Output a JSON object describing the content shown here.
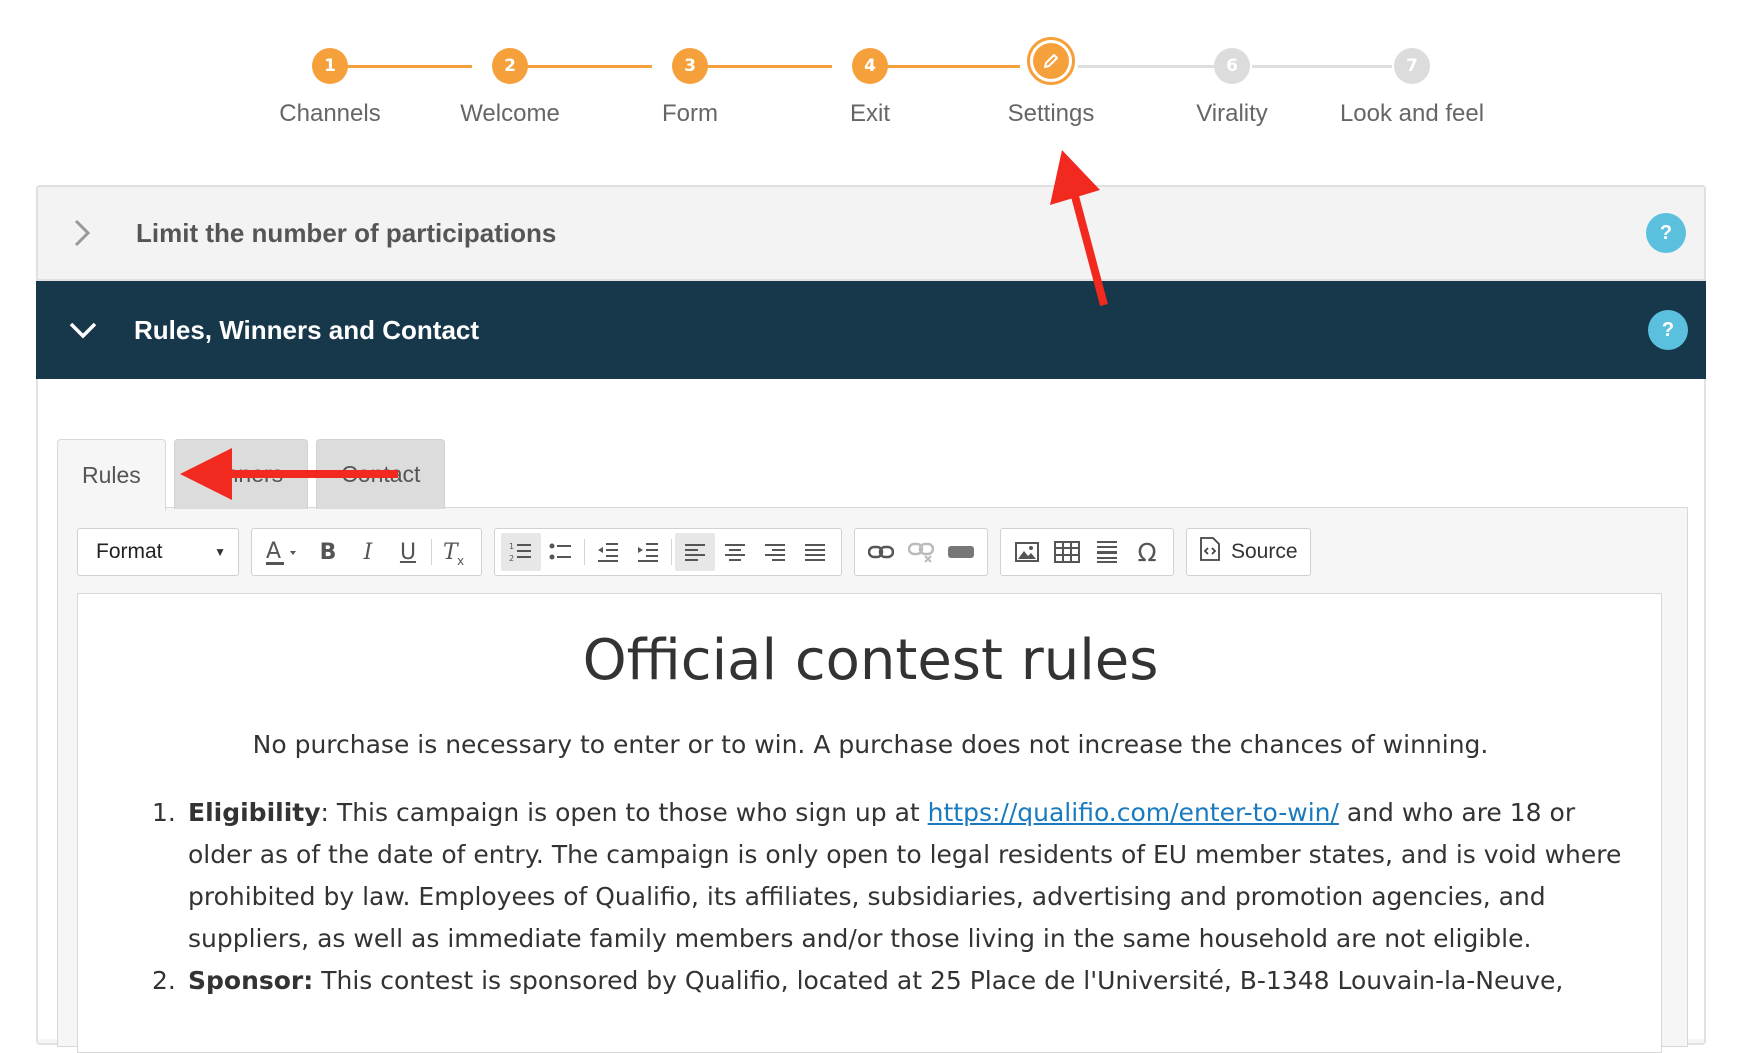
{
  "stepper": {
    "steps": [
      {
        "number": "1",
        "label": "Channels"
      },
      {
        "number": "2",
        "label": "Welcome"
      },
      {
        "number": "3",
        "label": "Form"
      },
      {
        "number": "4",
        "label": "Exit"
      },
      {
        "number": "",
        "label": "Settings"
      },
      {
        "number": "6",
        "label": "Virality"
      },
      {
        "number": "7",
        "label": "Look and feel"
      }
    ],
    "current_step": "Settings",
    "colors": {
      "done": "#f5a03a",
      "inactive": "#dcdcdc"
    }
  },
  "accordion": {
    "limit_title": "Limit the number of participations",
    "rules_title": "Rules, Winners and Contact",
    "help_label": "?"
  },
  "tabs": [
    "Rules",
    "Winners",
    "Contact"
  ],
  "active_tab": "Rules",
  "toolbar": {
    "format_label": "Format",
    "source_label": "Source",
    "icons": [
      "text-color-icon",
      "bold-icon",
      "italic-icon",
      "underline-icon",
      "remove-format-icon",
      "numbered-list-icon",
      "bulleted-list-icon",
      "outdent-icon",
      "indent-icon",
      "align-left-icon",
      "align-center-icon",
      "align-right-icon",
      "justify-icon",
      "link-icon",
      "unlink-icon",
      "anchor-icon",
      "image-icon",
      "table-icon",
      "horizontal-rule-icon",
      "special-char-icon"
    ]
  },
  "document": {
    "title": "Official contest rules",
    "intro": "No purchase is necessary to enter or to win. A purchase does not increase the chances of winning.",
    "items": [
      {
        "num": "1.",
        "heading": "Eligibility",
        "text_before": ": This campaign is open to those who sign up at ",
        "link": "https://qualifio.com/enter-to-win/",
        "text_after": " and who are 18 or older as of the date of entry. The campaign is only open to legal residents of EU member states, and is void where prohibited by law. Employees of Qualifio, its affiliates, subsidiaries, advertising and promotion agencies, and suppliers, as well as immediate family members and/or those living in the same household are not eligible."
      },
      {
        "num": "2.",
        "heading": "Sponsor:",
        "text_before": " This contest is sponsored by Qualifio, located at 25 Place de l'Université, B-1348 Louvain-la-Neuve,",
        "link": "",
        "text_after": ""
      }
    ]
  },
  "colors": {
    "accent": "#f5a03a",
    "header_dark": "#17374a",
    "help": "#5bc0de",
    "link": "#1a7abf",
    "annotation": "#f2291e"
  }
}
